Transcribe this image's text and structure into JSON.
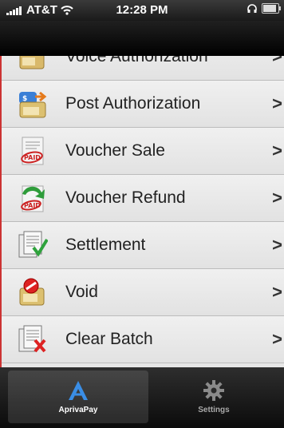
{
  "status": {
    "carrier": "AT&T",
    "time": "12:28 PM"
  },
  "menu": {
    "items": [
      {
        "label": "Voice Authorization",
        "icon": "voice-authorization-icon"
      },
      {
        "label": "Post Authorization",
        "icon": "post-authorization-icon"
      },
      {
        "label": "Voucher Sale",
        "icon": "voucher-sale-icon"
      },
      {
        "label": "Voucher Refund",
        "icon": "voucher-refund-icon"
      },
      {
        "label": "Settlement",
        "icon": "settlement-icon"
      },
      {
        "label": "Void",
        "icon": "void-icon"
      },
      {
        "label": "Clear Batch",
        "icon": "clear-batch-icon"
      }
    ],
    "chevron": ">"
  },
  "tabs": [
    {
      "label": "AprivaPay",
      "icon": "aprivapay-icon",
      "active": true
    },
    {
      "label": "Settings",
      "icon": "gear-icon",
      "active": false
    }
  ]
}
